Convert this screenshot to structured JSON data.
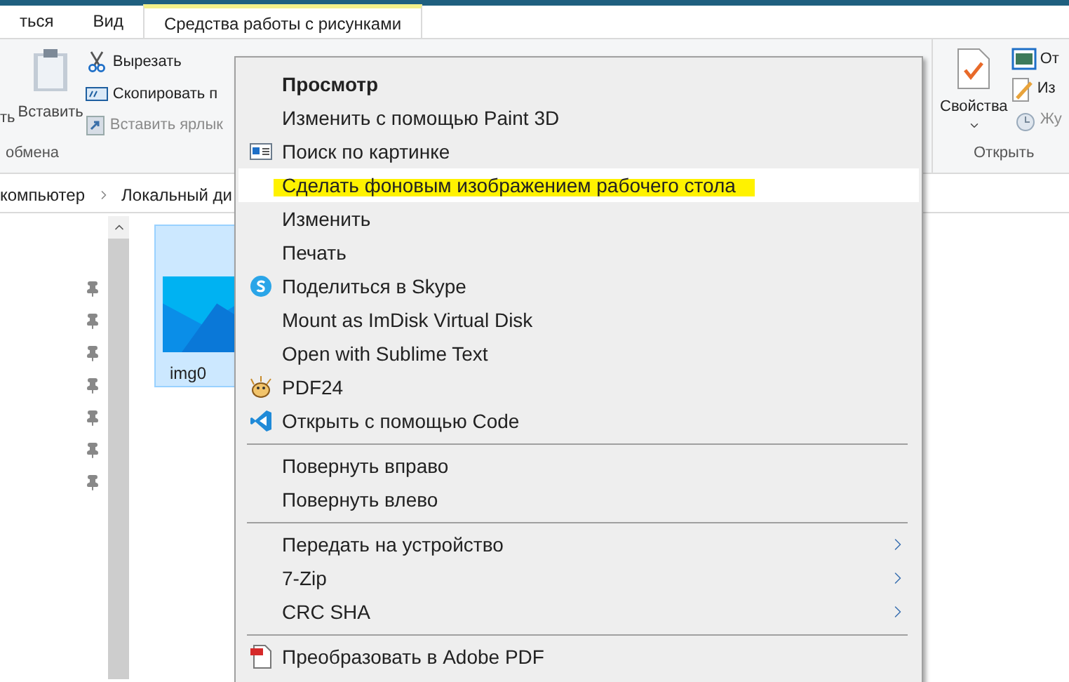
{
  "tabs": [
    {
      "label": "ться",
      "selected": false
    },
    {
      "label": "Вид",
      "selected": false
    },
    {
      "label": "Средства работы с рисунками",
      "selected": true
    }
  ],
  "ribbon": {
    "clipboard": {
      "cut_label": "ть",
      "paste": "Вставить",
      "actions": [
        {
          "label": "Вырезать",
          "kind": "cut",
          "disabled": false
        },
        {
          "label": "Скопировать п",
          "kind": "copy-path",
          "disabled": false
        },
        {
          "label": "Вставить ярлык",
          "kind": "paste-shortcut",
          "disabled": true
        }
      ],
      "group_label": "обмена"
    },
    "open": {
      "properties": "Свойства",
      "actions": [
        {
          "label": "От",
          "kind": "open",
          "disabled": false
        },
        {
          "label": "Из",
          "kind": "edit",
          "disabled": false
        },
        {
          "label": "Жу",
          "kind": "history",
          "disabled": true
        }
      ],
      "group_label": "Открыть"
    }
  },
  "address": [
    "компьютер",
    "Локальный ди"
  ],
  "file": {
    "name": "img0",
    "selected": true
  },
  "context_menu": {
    "items": [
      {
        "kind": "item",
        "label": "Просмотр",
        "bold": true,
        "selected": false,
        "marker": false,
        "submenu": false
      },
      {
        "kind": "item",
        "label": "Изменить с помощью Paint 3D",
        "bold": false,
        "selected": false,
        "marker": false,
        "submenu": false
      },
      {
        "kind": "item",
        "label": "Поиск по картинке",
        "bold": false,
        "selected": false,
        "marker": false,
        "submenu": false
      },
      {
        "kind": "item",
        "label": "Сделать фоновым изображением рабочего стола",
        "bold": false,
        "selected": true,
        "marker": true,
        "submenu": false
      },
      {
        "kind": "item",
        "label": "Изменить",
        "bold": false,
        "selected": false,
        "marker": false,
        "submenu": false
      },
      {
        "kind": "item",
        "label": "Печать",
        "bold": false,
        "selected": false,
        "marker": false,
        "submenu": false
      },
      {
        "kind": "item",
        "label": "Поделиться в Skype",
        "bold": false,
        "selected": false,
        "marker": false,
        "submenu": false
      },
      {
        "kind": "item",
        "label": "Mount as ImDisk Virtual Disk",
        "bold": false,
        "selected": false,
        "marker": false,
        "submenu": false
      },
      {
        "kind": "item",
        "label": "Open with Sublime Text",
        "bold": false,
        "selected": false,
        "marker": false,
        "submenu": false
      },
      {
        "kind": "item",
        "label": "PDF24",
        "bold": false,
        "selected": false,
        "marker": false,
        "submenu": false
      },
      {
        "kind": "item",
        "label": "Открыть с помощью Code",
        "bold": false,
        "selected": false,
        "marker": false,
        "submenu": false
      },
      {
        "kind": "separator"
      },
      {
        "kind": "item",
        "label": "Повернуть вправо",
        "bold": false,
        "selected": false,
        "marker": false,
        "submenu": false
      },
      {
        "kind": "item",
        "label": "Повернуть влево",
        "bold": false,
        "selected": false,
        "marker": false,
        "submenu": false
      },
      {
        "kind": "separator"
      },
      {
        "kind": "item",
        "label": "Передать на устройство",
        "bold": false,
        "selected": false,
        "marker": false,
        "submenu": true
      },
      {
        "kind": "item",
        "label": "7-Zip",
        "bold": false,
        "selected": false,
        "marker": false,
        "submenu": true
      },
      {
        "kind": "item",
        "label": "CRC SHA",
        "bold": false,
        "selected": false,
        "marker": false,
        "submenu": true
      },
      {
        "kind": "separator"
      },
      {
        "kind": "item",
        "label": "Преобразовать в Adobe PDF",
        "bold": false,
        "selected": false,
        "marker": false,
        "submenu": false
      }
    ]
  }
}
